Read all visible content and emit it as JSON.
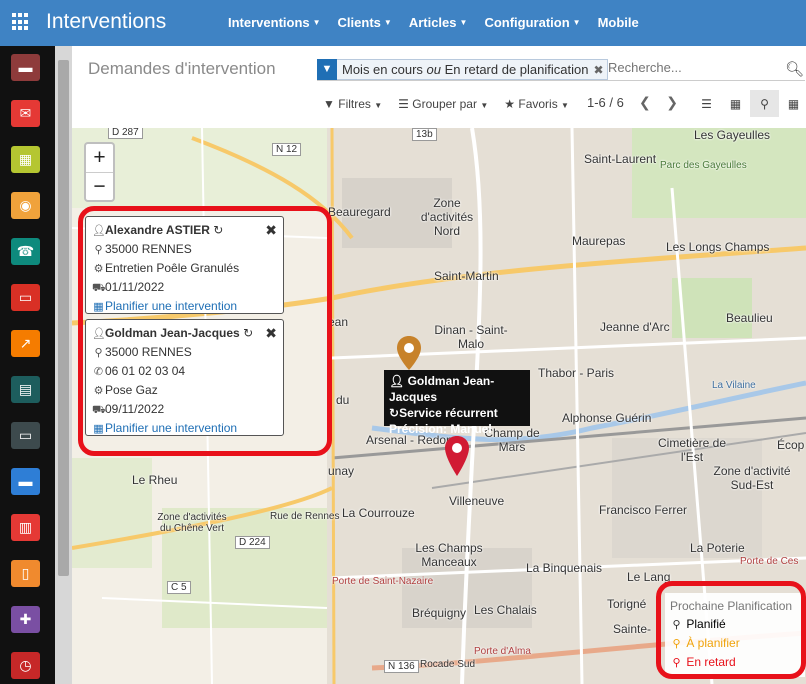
{
  "app": {
    "title": "Interventions"
  },
  "nav": {
    "items": [
      {
        "label": "Interventions"
      },
      {
        "label": "Clients"
      },
      {
        "label": "Articles"
      },
      {
        "label": "Configuration"
      },
      {
        "label": "Mobile"
      }
    ]
  },
  "sidebar": {
    "icons": [
      {
        "name": "discuss-icon",
        "color": "#8e3b3b"
      },
      {
        "name": "mail-icon",
        "color": "#e53935"
      },
      {
        "name": "calendar-icon",
        "color": "#b5c631"
      },
      {
        "name": "map-search-icon",
        "color": "#f0a23b"
      },
      {
        "name": "contacts-icon",
        "color": "#0e8a7d"
      },
      {
        "name": "folder-icon",
        "color": "#d93025"
      },
      {
        "name": "chart-icon",
        "color": "#f57c00"
      },
      {
        "name": "spreadsheet-icon",
        "color": "#1d5d5d"
      },
      {
        "name": "monitor-icon",
        "color": "#3d4a4d"
      },
      {
        "name": "card-icon",
        "color": "#2e7ed6"
      },
      {
        "name": "building-icon",
        "color": "#e53935"
      },
      {
        "name": "document-icon",
        "color": "#f08a2e"
      },
      {
        "name": "puzzle-icon",
        "color": "#7a4fa3"
      },
      {
        "name": "clock-icon",
        "color": "#c62828"
      }
    ]
  },
  "control": {
    "title": "Demandes d'intervention",
    "facet_part1": "Mois en cours",
    "facet_or": "ou",
    "facet_part2": "En retard de planification",
    "search_placeholder": "Recherche...",
    "filters_label": "Filtres",
    "group_label": "Grouper par",
    "favorites_label": "Favoris",
    "pager": "1-6 / 6"
  },
  "map": {
    "zoom_in": "+",
    "zoom_out": "−",
    "labels": {
      "saint_laurent": "Saint-Laurent",
      "les_gayeulles": "Les Gayeulles",
      "parc_gayeulles": "Parc des Gayeulles",
      "beauregard": "Beauregard",
      "zone_nord": "Zone d'activités Nord",
      "maurepas": "Maurepas",
      "longs_champs": "Les Longs Champs",
      "saint_martin": "Saint-Martin",
      "beaulieu": "Beaulieu",
      "jeanne_arc": "Jeanne d'Arc",
      "dinan_saint_malo": "Dinan - Saint-Malo",
      "thabor_paris": "Thabor - Paris",
      "alphonse_guerin": "Alphonse Guérin",
      "arsenal_redon": "Arsenal - Redon",
      "champ_mars": "Champ de Mars",
      "cimetiere_est": "Cimetière de l'Est",
      "villeneuve": "Villeneuve",
      "la_courrouze": "La Courrouze",
      "francisco_ferrer": "Francisco Ferrer",
      "zone_sud_est": "Zone d'activité Sud-Est",
      "champs_manceaux": "Les Champs Manceaux",
      "la_binquenais": "La Binquenais",
      "la_poterie": "La Poterie",
      "le_lang": "Le Lang",
      "brequigny": "Bréquigny",
      "les_chalais": "Les Chalais",
      "torigne": "Torigné",
      "sainte": "Sainte-",
      "le_rheu": "Le Rheu",
      "zone_chene_vert": "Zone d'activités du Chêne Vert",
      "unay": "unay",
      "ean": "ean",
      "du": "du",
      "ecop": "Écop",
      "la_vilaine": "La Vilaine",
      "porte_alma": "Porte d'Alma",
      "rocade_sud": "Rocade Sud",
      "rue_rennes": "Rue de Rennes",
      "porte_saint_nazaire": "Porte de Saint-Nazaire",
      "porte_cesson": "Porte de Ces"
    },
    "roads": {
      "d287": "D 287",
      "n12": "N 12",
      "d224": "D 224",
      "c5": "C 5",
      "n136": "N 136",
      "r13b": "13b"
    }
  },
  "cards": [
    {
      "name": "Alexandre ASTIER",
      "city": "35000 RENNES",
      "service": "Entretien Poêle Granulés",
      "date": "01/11/2022",
      "link": "Planifier une intervention"
    },
    {
      "name": "Goldman Jean-Jacques",
      "city": "35000 RENNES",
      "phone": "06 01 02 03 04",
      "service": "Pose Gaz",
      "date": "09/11/2022",
      "link": "Planifier une intervention"
    }
  ],
  "tooltip": {
    "name": "Goldman Jean-Jacques",
    "service": "Service récurrent",
    "precision": "Précision: Manuel"
  },
  "legend": {
    "title": "Prochaine Planification",
    "items": [
      {
        "label": "Planifié",
        "color": "#333333"
      },
      {
        "label": "À planifier",
        "color": "#f0a30a"
      },
      {
        "label": "En retard",
        "color": "#e8111a"
      }
    ]
  },
  "colors": {
    "topbar": "#3f83c4",
    "highlight": "#e8111a",
    "link": "#1f6fb5",
    "marker_orange": "#c7822a",
    "marker_red": "#d11a33"
  }
}
